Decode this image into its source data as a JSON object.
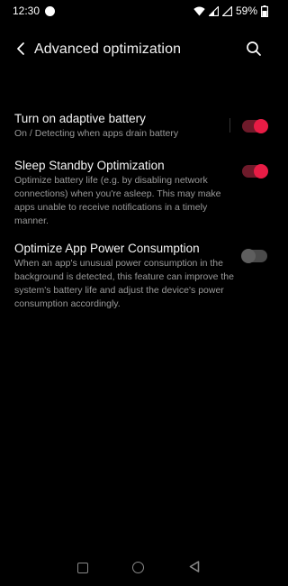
{
  "status_bar": {
    "time": "12:30",
    "battery": "59%"
  },
  "toolbar": {
    "title": "Advanced optimization"
  },
  "settings": [
    {
      "title": "Turn on adaptive battery",
      "description": "On / Detecting when apps drain battery",
      "enabled": true
    },
    {
      "title": "Sleep Standby Optimization",
      "description": "Optimize battery life (e.g. by disabling network connections) when you're asleep. This may make apps unable to receive notifications in a timely manner.",
      "enabled": true
    },
    {
      "title": "Optimize App Power Consumption",
      "description": "When an app's unusual power consumption in the background is detected, this feature can improve the system's battery life and adjust the device's power consumption accordingly.",
      "enabled": false
    }
  ],
  "colors": {
    "accent": "#e81c45",
    "background": "#000000"
  }
}
